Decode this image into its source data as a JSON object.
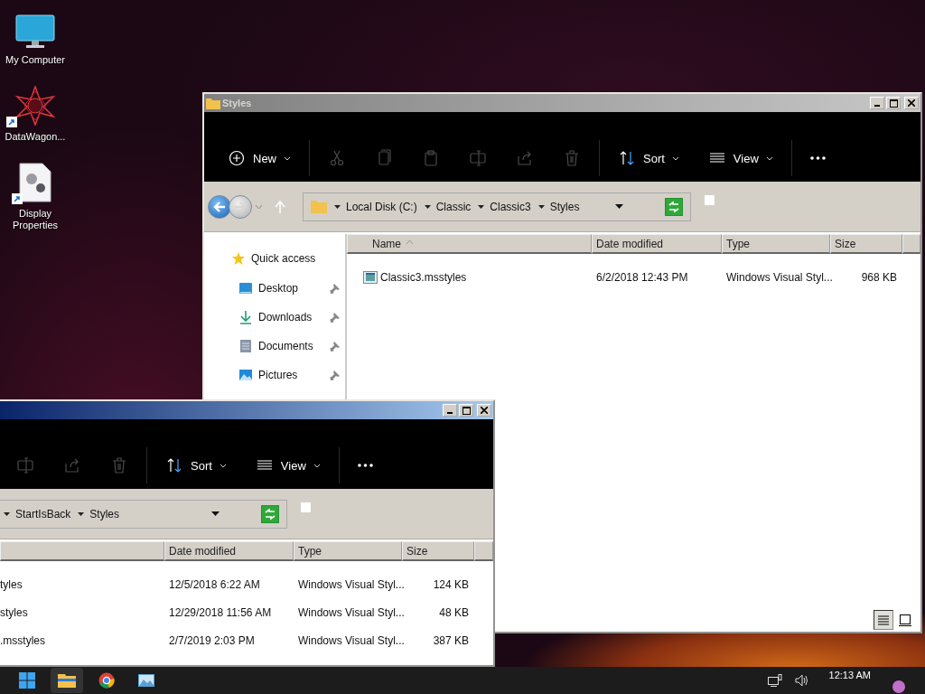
{
  "desktop_icons": [
    {
      "kind": "computer",
      "label": "My Computer",
      "shortcut": false
    },
    {
      "kind": "app",
      "label": "DataWagon...",
      "shortcut": true
    },
    {
      "kind": "settings-file",
      "label": "Display Properties",
      "shortcut": true
    }
  ],
  "windows": [
    {
      "title": "Styles",
      "active": false,
      "nav_buttons": true,
      "row_icons": true,
      "ribbon": [
        {
          "kind": "new",
          "label": "New",
          "disabled": false
        },
        {
          "kind": "cut",
          "disabled": true
        },
        {
          "kind": "copy",
          "disabled": true
        },
        {
          "kind": "paste",
          "disabled": true
        },
        {
          "kind": "rename",
          "disabled": true
        },
        {
          "kind": "share",
          "disabled": true
        },
        {
          "kind": "delete",
          "disabled": true
        },
        {
          "kind": "sort",
          "label": "Sort",
          "disabled": false
        },
        {
          "kind": "view",
          "label": "View",
          "disabled": false
        },
        {
          "kind": "more",
          "disabled": false
        }
      ],
      "address": {
        "folder_icon": true,
        "segments": [
          "Local Disk (C:)",
          "Classic",
          "Classic3",
          "Styles"
        ]
      },
      "nav": [
        {
          "kind": "star",
          "label": "Quick access",
          "pinned": false
        },
        {
          "kind": "desktop",
          "label": "Desktop",
          "pinned": true
        },
        {
          "kind": "download",
          "label": "Downloads",
          "pinned": true
        },
        {
          "kind": "documents",
          "label": "Documents",
          "pinned": true
        },
        {
          "kind": "pictures",
          "label": "Pictures",
          "pinned": true
        }
      ],
      "columns": [
        {
          "kind": "name",
          "label": "Name",
          "sorted": true
        },
        {
          "kind": "date",
          "label": "Date modified",
          "sorted": false
        },
        {
          "kind": "type",
          "label": "Type",
          "sorted": false
        },
        {
          "kind": "size",
          "label": "Size",
          "sorted": false
        }
      ],
      "rows": [
        {
          "name": "Classic3.msstyles",
          "date": "6/2/2018 12:43 PM",
          "type": "Windows Visual Styl...",
          "size": "968 KB"
        }
      ],
      "view_buttons": [
        {
          "kind": "details",
          "selected": true
        },
        {
          "kind": "tiles",
          "selected": false
        }
      ]
    },
    {
      "active": true,
      "nav_buttons": false,
      "row_icons": false,
      "ribbon": [
        {
          "kind": "rename",
          "disabled": true
        },
        {
          "kind": "share",
          "disabled": true
        },
        {
          "kind": "delete",
          "disabled": true
        },
        {
          "kind": "sort",
          "label": "Sort",
          "disabled": false
        },
        {
          "kind": "view",
          "label": "View",
          "disabled": false
        },
        {
          "kind": "more",
          "disabled": false
        }
      ],
      "address": {
        "folder_icon": false,
        "segments": [
          "StartIsBack",
          "Styles"
        ]
      },
      "columns": [
        {
          "kind": "date",
          "label": "Date modified",
          "sorted": false
        },
        {
          "kind": "type",
          "label": "Type",
          "sorted": false
        },
        {
          "kind": "size",
          "label": "Size",
          "sorted": false
        }
      ],
      "rows": [
        {
          "name": "tyles",
          "date": "12/5/2018 6:22 AM",
          "type": "Windows Visual Styl...",
          "size": "124 KB"
        },
        {
          "name": "styles",
          "date": "12/29/2018 11:56 AM",
          "type": "Windows Visual Styl...",
          "size": "48 KB"
        },
        {
          "name": ".msstyles",
          "date": "2/7/2019 2:03 PM",
          "type": "Windows Visual Styl...",
          "size": "387 KB"
        }
      ]
    }
  ],
  "taskbar": {
    "apps": [
      {
        "kind": "start",
        "selected": false
      },
      {
        "kind": "explorer",
        "selected": true
      },
      {
        "kind": "chrome",
        "selected": false
      },
      {
        "kind": "photos",
        "selected": false
      }
    ],
    "clock": "12:13 AM"
  }
}
